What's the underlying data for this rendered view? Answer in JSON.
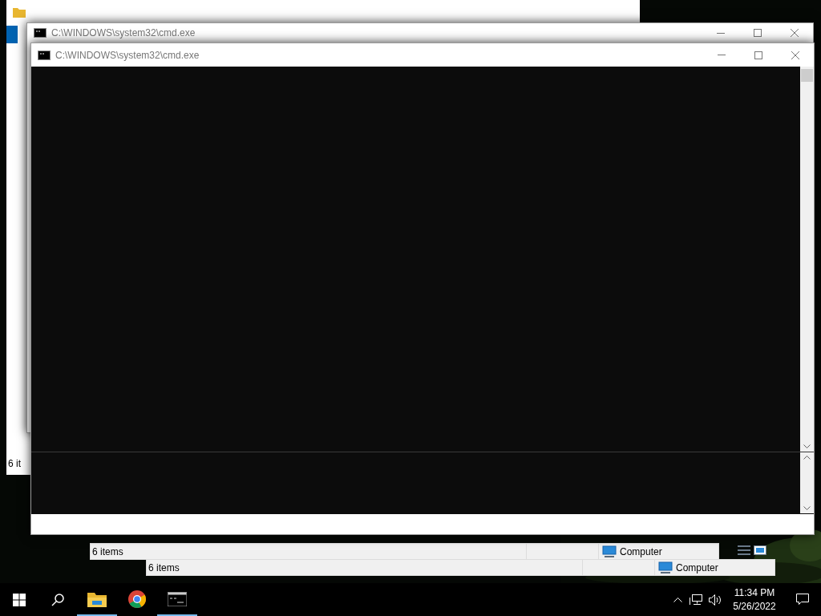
{
  "explorer_back": {
    "status": "6 it"
  },
  "explorer_windows": [
    {
      "status": "6 items",
      "location": "Computer"
    },
    {
      "status": "6 items",
      "location": "Computer"
    }
  ],
  "cmd_windows": [
    {
      "title": "C:\\WINDOWS\\system32\\cmd.exe"
    },
    {
      "title": "C:\\WINDOWS\\system32\\cmd.exe"
    }
  ],
  "taskbar": {
    "apps": [
      {
        "kind": "explorer",
        "running": true
      },
      {
        "kind": "chrome",
        "running": false
      },
      {
        "kind": "cmd",
        "running": true
      }
    ],
    "time": "11:34 PM",
    "date": "5/26/2022"
  }
}
